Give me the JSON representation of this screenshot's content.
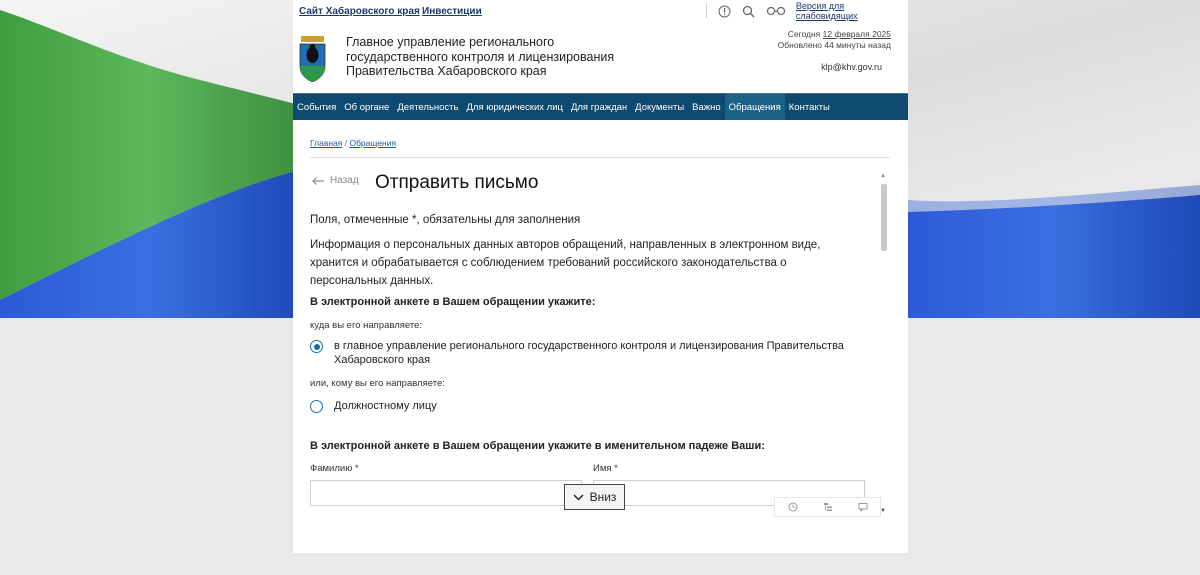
{
  "topbar": {
    "link_region": "Сайт Хабаровского края",
    "link_investments": "Инвестиции",
    "vision_link": "Версия для слабовидящих"
  },
  "header": {
    "org_title": "Главное управление регионального государственного контроля и лицензирования Правительства Хабаровского края",
    "today_label": "Сегодня",
    "today_date": "12 февраля 2025",
    "updated": "Обновлено 44 минуты назад",
    "email": "klp@khv.gov.ru"
  },
  "nav": {
    "items": [
      "События",
      "Об органе",
      "Деятельность",
      "Для юридических лиц",
      "Для граждан",
      "Документы",
      "Важно",
      "Обращения",
      "Контакты"
    ],
    "active": "Обращения"
  },
  "breadcrumb": {
    "home": "Главная",
    "separator": " / ",
    "current": "Обращения"
  },
  "form": {
    "back": "Назад",
    "title": "Отправить письмо",
    "required_note": "Поля, отмеченные *, обязательны для заполнения",
    "info": "Информация о персональных данных авторов обращений, направленных в электронном виде, хранится и обрабатывается с соблюдением требований российского законодательства о персональных данных.",
    "section1_heading": "В электронной анкете в Вашем обращении укажите:",
    "where_label": "куда вы его направляете:",
    "option1": "в главное управление регионального государственного контроля и лицензирования Правительства Хабаровского края",
    "option1_selected": true,
    "or_label": "или, кому вы его направляете:",
    "option2": "Должностному лицу",
    "option2_selected": false,
    "section2_heading": "В электронной анкете в Вашем обращении укажите в именительном падеже Ваши:",
    "surname_label": "Фамилию *",
    "name_label": "Имя *",
    "surname_value": "",
    "name_value": ""
  },
  "down_button": "Вниз",
  "colors": {
    "nav_bg": "#0e4a6f",
    "nav_active": "#1a6288",
    "flag_green": "#4aa84a",
    "flag_blue": "#2a5bd0",
    "link": "#1b3a6b"
  }
}
